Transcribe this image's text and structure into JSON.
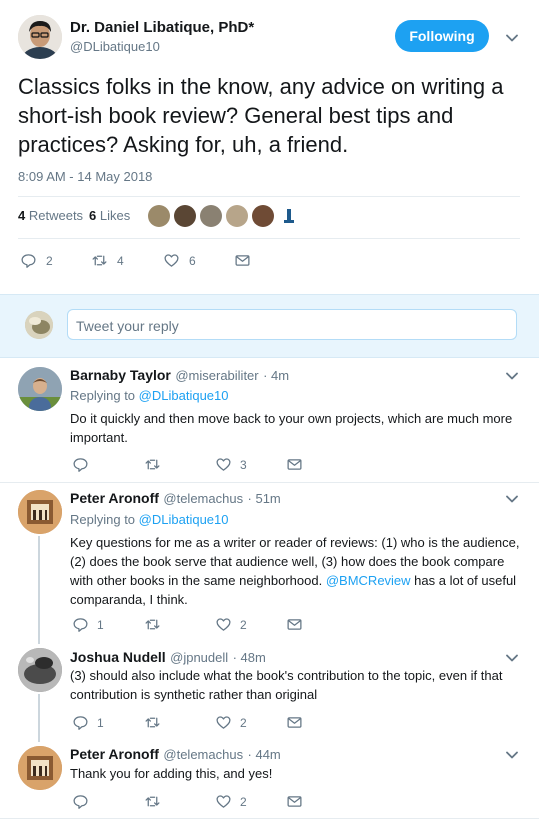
{
  "main_tweet": {
    "author_name": "Dr. Daniel Libatique, PhD*",
    "author_handle": "@DLibatique10",
    "follow_label": "Following",
    "text": "Classics folks in the know, any advice on writing a short-ish book review? General best tips and practices? Asking for, uh, a friend.",
    "timestamp": "8:09 AM - 14 May 2018",
    "retweets_count": "4",
    "retweets_label": "Retweets",
    "likes_count": "6",
    "likes_label": "Likes",
    "reply_count": "2",
    "retweet_count": "4",
    "like_count": "6"
  },
  "reply_box": {
    "placeholder": "Tweet your reply"
  },
  "replies": [
    {
      "name": "Barnaby Taylor",
      "handle": "@miserabiliter",
      "time": "· 4m",
      "replying_to_label": "Replying to",
      "replying_to_handle": "@DLibatique10",
      "text": "Do it quickly and then move back to your own projects, which are much more important.",
      "reply_count": "",
      "retweet_count": "",
      "like_count": "3"
    },
    {
      "name": "Peter Aronoff",
      "handle": "@telemachus",
      "time": "· 51m",
      "replying_to_label": "Replying to",
      "replying_to_handle": "@DLibatique10",
      "text_before": "Key questions for me as a writer or reader of reviews: (1) who is the audience, (2) does the book serve that audience well, (3) how does the book compare with other books in the same neighborhood. ",
      "mention": "@BMCReview",
      "text_after": " has a lot of useful comparanda, I think.",
      "reply_count": "1",
      "retweet_count": "",
      "like_count": "2"
    },
    {
      "name": "Joshua Nudell",
      "handle": "@jpnudell",
      "time": "· 48m",
      "text": "(3) should also include what the book's contribution to the topic, even if that contribution is synthetic rather than original",
      "reply_count": "1",
      "retweet_count": "",
      "like_count": "2"
    },
    {
      "name": "Peter Aronoff",
      "handle": "@telemachus",
      "time": "· 44m",
      "text": "Thank you for adding this, and yes!",
      "reply_count": "",
      "retweet_count": "",
      "like_count": "2"
    }
  ]
}
